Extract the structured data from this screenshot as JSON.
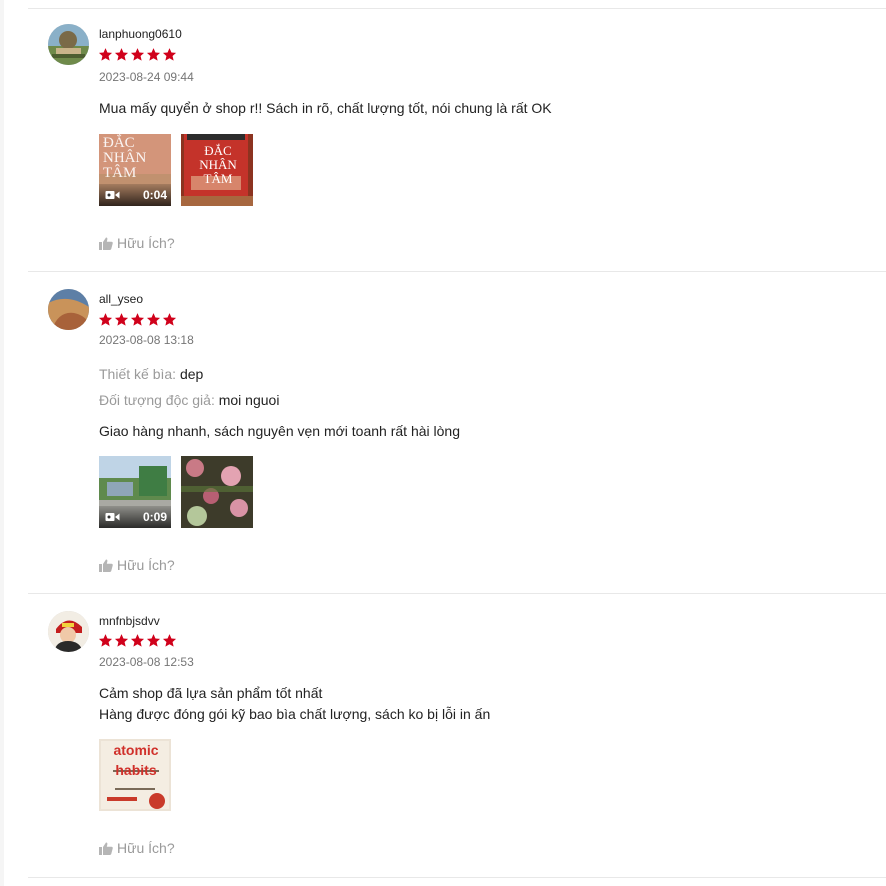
{
  "colors": {
    "star": "#d0011b",
    "muted": "#9a9a9a"
  },
  "reviews": [
    {
      "author": "lanphuong0610",
      "rating": 5,
      "date": "2023-08-24 09:44",
      "attributes": [],
      "comment": "Mua mấy quyển ở shop r!! Sách in rõ, chất lượng tốt, nói chung là rất OK",
      "media": [
        {
          "type": "video",
          "duration": "0:04",
          "cover_text": "ĐẮC NHÂN TÂM"
        },
        {
          "type": "image",
          "cover_text": "ĐẮC NHÂN TÂM"
        }
      ],
      "helpful_label": "Hữu Ích?"
    },
    {
      "author": "all_yseo",
      "rating": 5,
      "date": "2023-08-08 13:18",
      "attributes": [
        {
          "key": "Thiết kế bìa:",
          "value": "dep"
        },
        {
          "key": "Đối tượng độc giả:",
          "value": "moi nguoi"
        }
      ],
      "comment": "Giao hàng nhanh, sách nguyên vẹn mới toanh rất hài lòng",
      "media": [
        {
          "type": "video",
          "duration": "0:09"
        },
        {
          "type": "image"
        }
      ],
      "helpful_label": "Hữu Ích?"
    },
    {
      "author": "mnfnbjsdvv",
      "rating": 5,
      "date": "2023-08-08 12:53",
      "attributes": [],
      "comment": "Cảm shop đã lựa sản phẩm tốt nhất\nHàng được đóng gói kỹ bao bìa chất lượng, sách ko bị lỗi in ấn",
      "media": [
        {
          "type": "image",
          "cover_text": "atomic habits"
        }
      ],
      "helpful_label": "Hữu Ích?"
    }
  ]
}
